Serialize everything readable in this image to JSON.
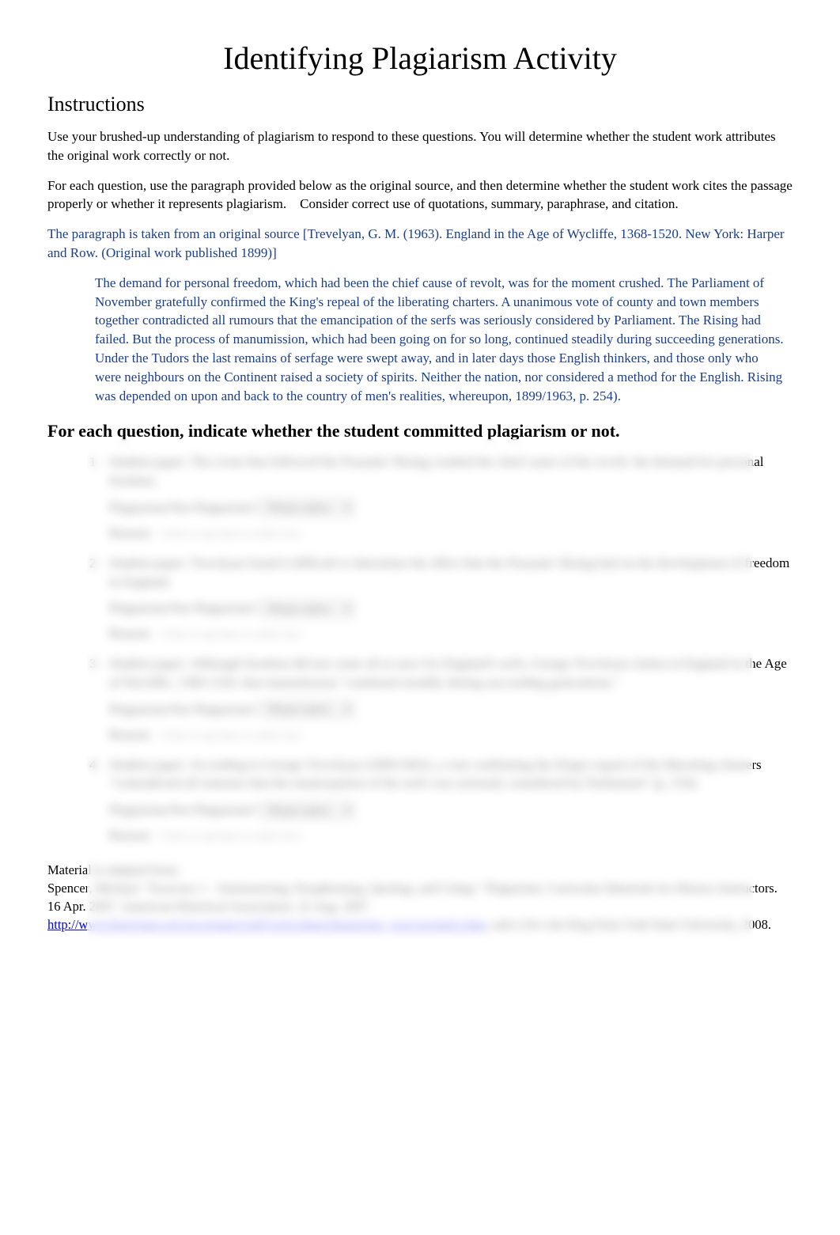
{
  "title": "Identifying Plagiarism Activity",
  "instructions_heading": "Instructions",
  "intro_p1": "Use your brushed-up understanding of plagiarism to respond to these questions. You will determine whether the student work attributes the original work correctly or not.",
  "intro_p2": "For each question, use the paragraph provided below as the original source, and then determine whether the student work cites the passage properly or whether it represents plagiarism. Consider correct use of quotations, summary, paraphrase, and citation.",
  "source_note": "The paragraph is taken from an original source [Trevelyan, G. M. (1963). England in the Age of Wycliffe, 1368-1520. New York: Harper and Row. (Original work published 1899)]",
  "quote": "The demand for personal freedom, which had been the chief cause of revolt, was for the moment crushed. The Parliament of November gratefully confirmed the King's repeal of the liberating charters. A unanimous vote of county and town members together contradicted all rumours that the emancipation of the serfs was seriously considered by Parliament. The Rising had failed. But the process of manumission, which had been going on for so long, continued steadily during succeeding generations. Under the Tudors the last remains of serfage were swept away, and in later days those English thinkers, and those only who were neighbours on the Continent raised a society of spirits. Neither the nation, nor considered a method for the English. Rising was depended on upon and back to the country of men's realities, whereupon, 1899/1963, p. 254).",
  "question_heading": "For each question, indicate whether the student committed plagiarism or not.",
  "student_prefix": "Student paper:",
  "pnp_label": "Plagiarism/Not Plagiarism?",
  "select_placeholder": "Please select...",
  "reason_label": "Reason:",
  "reason_placeholder": "Click or tap here to enter text.",
  "questions": [
    {
      "text": "The event that followed the Peasants' Rising crushed the chief cause of the revolt: the demand for personal freedom."
    },
    {
      "text": "Trevelyan found it difficult to determine the effect that the Peasants' Rising had on the development of freedom in England."
    },
    {
      "text": "Although freedom did not come all at once for England's serfs, George Trevelyan claims in England in the Age of Wycliffe, 1368-1520, that manumission \"continued steadily during succeeding generations.\""
    },
    {
      "text": "According to George Trevelyan (1899/1963), a vote confirming the King's repeal of the liberating charters \"contradicted all rumours that the emancipation of the serfs was seriously considered by Parliament\" (p. 254)."
    }
  ],
  "adapted_heading": "Material is adapted from:",
  "adapted_citation": "Spencer, Michael. \"Exercise 1 – Summarizing, Paraphrasing, Quoting, and Citing.\" Plagiarism: Curricular Materials for History Instructors. 16 Apr. 2007. American Historical Association. 22 Aug. 2007",
  "adapted_link_text": "http://www.historians.org/governance/pd/Curriculum/plagiarism_exercisesintro.htm",
  "adapted_footer": ", and a live site blog from Utah State University, 2008."
}
